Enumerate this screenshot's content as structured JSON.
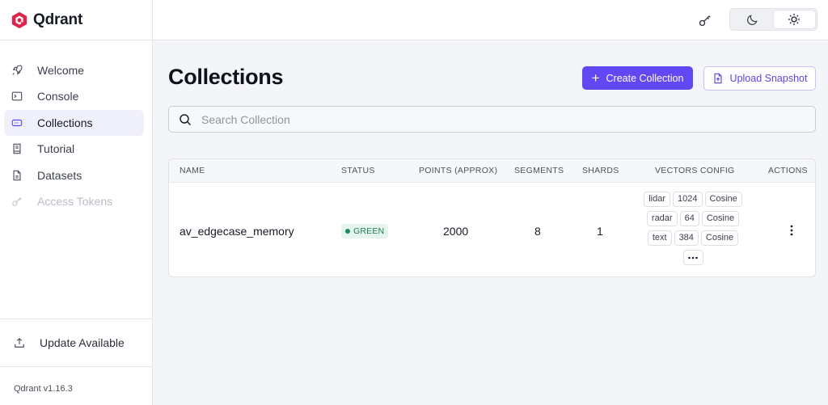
{
  "brand": {
    "name": "Qdrant",
    "logo_color": "#dc244c"
  },
  "sidebar": {
    "items": [
      {
        "label": "Welcome",
        "icon": "rocket-icon"
      },
      {
        "label": "Console",
        "icon": "terminal-icon"
      },
      {
        "label": "Collections",
        "icon": "collections-icon",
        "active": true
      },
      {
        "label": "Tutorial",
        "icon": "book-icon"
      },
      {
        "label": "Datasets",
        "icon": "file-icon"
      },
      {
        "label": "Access Tokens",
        "icon": "key-icon",
        "disabled": true
      }
    ],
    "update_label": "Update Available",
    "version": "Qdrant v1.16.3"
  },
  "topbar": {
    "key_icon": "key-icon",
    "theme": {
      "dark_icon": "moon-icon",
      "light_icon": "sun-icon",
      "selected": "light"
    }
  },
  "main": {
    "title": "Collections",
    "create_label": "Create Collection",
    "upload_label": "Upload Snapshot",
    "search_placeholder": "Search Collection",
    "accent": "#6148f2"
  },
  "table": {
    "headers": [
      "NAME",
      "STATUS",
      "POINTS (APPROX)",
      "SEGMENTS",
      "SHARDS",
      "VECTORS CONFIG",
      "ACTIONS"
    ],
    "rows": [
      {
        "name": "av_edgecase_memory",
        "status": "GREEN",
        "points": "2000",
        "segments": "8",
        "shards": "1",
        "vectors": [
          [
            "lidar",
            "1024",
            "Cosine"
          ],
          [
            "radar",
            "64",
            "Cosine"
          ],
          [
            "text",
            "384",
            "Cosine"
          ]
        ],
        "more": "•••"
      }
    ]
  }
}
